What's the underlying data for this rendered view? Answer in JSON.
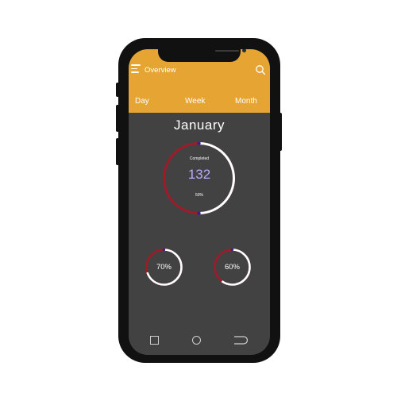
{
  "header": {
    "title": "Overview",
    "tabs": [
      {
        "label": "Day"
      },
      {
        "label": "Week"
      },
      {
        "label": "Month"
      }
    ]
  },
  "summary": {
    "period": "January",
    "label": "Completed",
    "count": "132",
    "percent_text": "50%",
    "progress": 0.5
  },
  "rings": [
    {
      "label": "70%",
      "progress": 0.7
    },
    {
      "label": "60%",
      "progress": 0.6
    }
  ],
  "colors": {
    "header": "#e6a532",
    "background": "#424242",
    "ring_track": "#9e1b2a",
    "ring_progress": "#ffffff",
    "ring_accent": "#3a1e8a",
    "count": "#b9a9ff"
  },
  "icons": {
    "menu": "menu-icon",
    "search": "search-icon",
    "nav": [
      "square-back-icon",
      "circle-home-icon",
      "recent-apps-icon"
    ]
  }
}
